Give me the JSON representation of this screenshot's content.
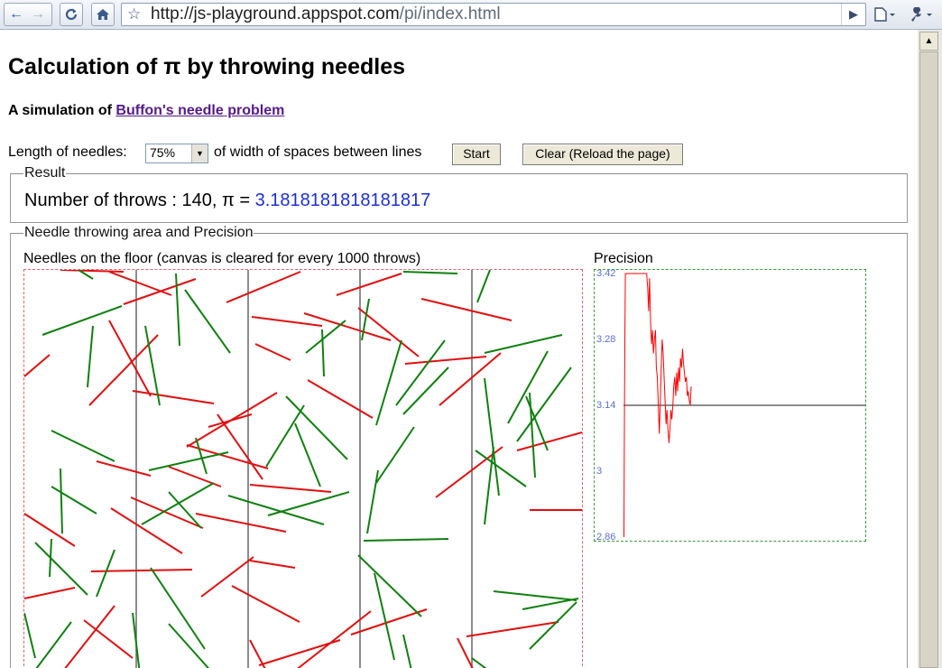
{
  "browser": {
    "url_host": "http://js-playground.appspot.com",
    "url_path": "/pi/index.html"
  },
  "page": {
    "title": "Calculation of π by throwing needles",
    "subtitle_prefix": "A simulation of ",
    "subtitle_link": "Buffon's needle problem",
    "controls": {
      "length_label": "Length of needles:",
      "length_value": "75%",
      "length_suffix": "of width of spaces between lines",
      "start_label": "Start",
      "clear_label": "Clear (Reload the page)"
    },
    "result": {
      "legend": "Result",
      "throws_prefix": "Number of throws : ",
      "throws": "140",
      "pi_prefix": ", π = ",
      "pi_value": "3.1818181818181817"
    },
    "area": {
      "legend": "Needle throwing area and Precision",
      "needles_label": "Needles on the floor (canvas is cleared for every 1000 throws)",
      "precision_label": "Precision",
      "y_ticks": [
        "3.42",
        "3.28",
        "3.14",
        "3",
        "2.86"
      ]
    }
  },
  "chart_data": {
    "type": "line",
    "title": "Precision",
    "reference_value": 3.14,
    "ylim": [
      2.86,
      3.42
    ],
    "y_ticks": [
      3.42,
      3.28,
      3.14,
      3.0,
      2.86
    ],
    "series": [
      {
        "color": "#ff0000",
        "x": [
          1,
          2,
          3,
          4,
          5,
          6,
          8,
          10,
          12,
          14,
          16,
          18,
          20,
          22,
          24,
          26,
          28,
          30,
          32,
          34,
          36,
          38,
          40,
          42,
          44,
          46,
          48,
          50,
          52,
          54,
          56,
          58,
          60,
          62,
          64,
          66,
          68,
          70,
          72,
          74,
          76,
          78,
          80,
          82,
          84,
          86,
          88,
          90,
          92,
          94,
          96,
          98,
          100,
          102,
          104,
          106,
          108,
          110,
          112,
          114,
          116,
          118,
          120,
          122,
          124,
          126,
          128,
          130,
          132,
          134,
          136,
          138,
          140
        ],
        "values": [
          2.86,
          3.14,
          3.3,
          3.42,
          3.42,
          3.42,
          3.42,
          3.42,
          3.42,
          3.42,
          3.42,
          3.42,
          3.42,
          3.42,
          3.42,
          3.42,
          3.42,
          3.42,
          3.42,
          3.42,
          3.42,
          3.42,
          3.42,
          3.42,
          3.42,
          3.42,
          3.42,
          3.39,
          3.34,
          3.41,
          3.32,
          3.27,
          3.3,
          3.25,
          3.28,
          3.3,
          3.22,
          3.2,
          3.14,
          3.08,
          3.14,
          3.22,
          3.28,
          3.25,
          3.2,
          3.15,
          3.1,
          3.13,
          3.09,
          3.06,
          3.09,
          3.13,
          3.11,
          3.14,
          3.18,
          3.2,
          3.16,
          3.21,
          3.17,
          3.22,
          3.19,
          3.24,
          3.22,
          3.26,
          3.23,
          3.21,
          3.19,
          3.2,
          3.16,
          3.17,
          3.15,
          3.14,
          3.18
        ]
      }
    ]
  }
}
